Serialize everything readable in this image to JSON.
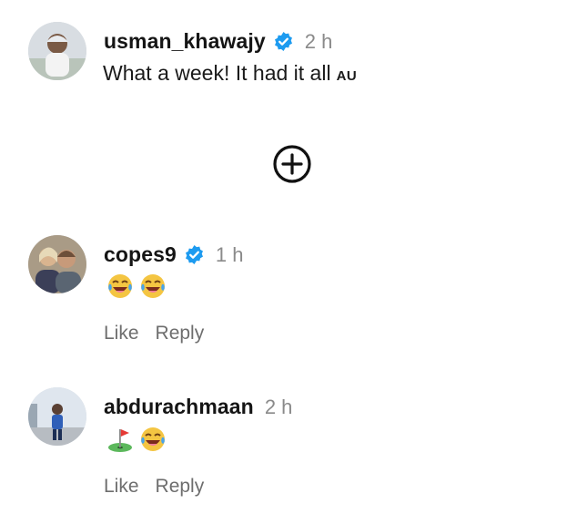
{
  "post": {
    "username": "usman_khawajy",
    "time": "2 h",
    "caption": "What a week! It had it all",
    "flag_text": "AU",
    "verified_icon": "verified-badge-icon"
  },
  "expand_icon": "plus-circle-icon",
  "comments": [
    {
      "username": "copes9",
      "time": "1 h",
      "verified": true,
      "emojis": [
        "laughing-tears-emoji",
        "laughing-tears-emoji"
      ],
      "like_label": "Like",
      "reply_label": "Reply"
    },
    {
      "username": "abdurachmaan",
      "time": "2 h",
      "verified": false,
      "emojis": [
        "golf-flag-emoji",
        "laughing-tears-emoji"
      ],
      "like_label": "Like",
      "reply_label": "Reply"
    }
  ],
  "colors": {
    "verified_blue": "#1d9bf0",
    "muted_text": "#6e6e6e",
    "time_text": "#8a8a8a"
  }
}
